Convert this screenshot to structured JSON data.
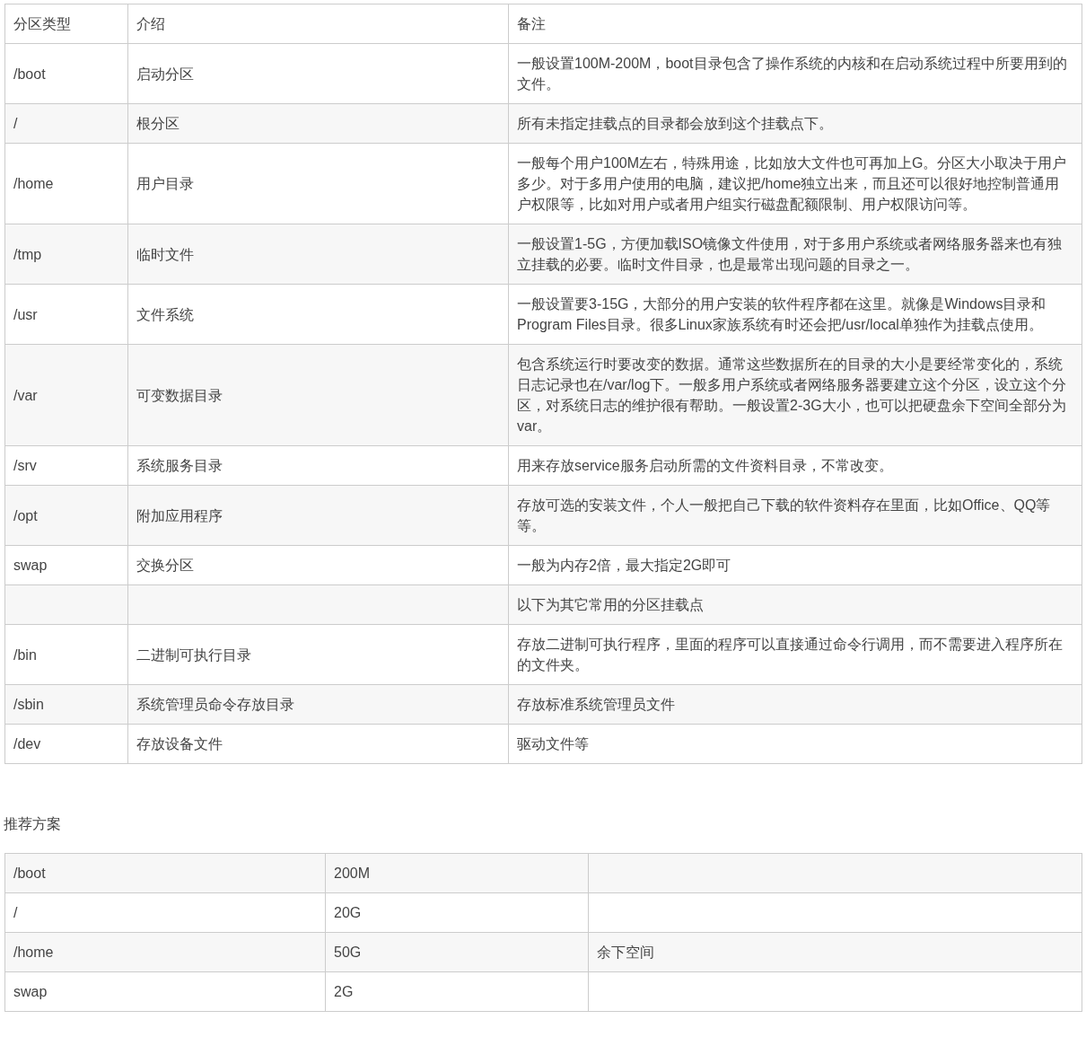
{
  "partition_table": {
    "columns": [
      "分区类型",
      "介绍",
      "备注"
    ],
    "rows": [
      {
        "cells": [
          "/boot",
          "启动分区",
          "一般设置100M-200M，boot目录包含了操作系统的内核和在启动系统过程中所要用到的文件。"
        ]
      },
      {
        "cells": [
          "/",
          "根分区",
          "所有未指定挂载点的目录都会放到这个挂载点下。"
        ]
      },
      {
        "cells": [
          "/home",
          "用户目录",
          "一般每个用户100M左右，特殊用途，比如放大文件也可再加上G。分区大小取决于用户多少。对于多用户使用的电脑，建议把/home独立出来，而且还可以很好地控制普通用户权限等，比如对用户或者用户组实行磁盘配额限制、用户权限访问等。"
        ]
      },
      {
        "cells": [
          "/tmp",
          "临时文件",
          "一般设置1-5G，方便加载ISO镜像文件使用，对于多用户系统或者网络服务器来也有独立挂载的必要。临时文件目录，也是最常出现问题的目录之一。"
        ]
      },
      {
        "cells": [
          "/usr",
          "文件系统",
          "一般设置要3-15G，大部分的用户安装的软件程序都在这里。就像是Windows目录和Program Files目录。很多Linux家族系统有时还会把/usr/local单独作为挂载点使用。"
        ]
      },
      {
        "cells": [
          "/var",
          "可变数据目录",
          "包含系统运行时要改变的数据。通常这些数据所在的目录的大小是要经常变化的，系统日志记录也在/var/log下。一般多用户系统或者网络服务器要建立这个分区，设立这个分区，对系统日志的维护很有帮助。一般设置2-3G大小，也可以把硬盘余下空间全部分为var。"
        ]
      },
      {
        "cells": [
          "/srv",
          "系统服务目录",
          "用来存放service服务启动所需的文件资料目录，不常改变。"
        ]
      },
      {
        "cells": [
          "/opt",
          "附加应用程序",
          "存放可选的安装文件，个人一般把自己下载的软件资料存在里面，比如Office、QQ等等。"
        ]
      },
      {
        "cells": [
          "swap",
          "交换分区",
          "一般为内存2倍，最大指定2G即可"
        ]
      },
      {
        "cells": [
          null,
          null,
          "以下为其它常用的分区挂载点"
        ]
      },
      {
        "cells": [
          "/bin",
          "二进制可执行目录",
          "存放二进制可执行程序，里面的程序可以直接通过命令行调用，而不需要进入程序所在的文件夹。"
        ]
      },
      {
        "cells": [
          "/sbin",
          "系统管理员命令存放目录",
          "存放标准系统管理员文件"
        ]
      },
      {
        "cells": [
          "/dev",
          "存放设备文件",
          "驱动文件等"
        ]
      }
    ]
  },
  "recommendation_heading": "推荐方案",
  "recommendation_table": {
    "rows": [
      {
        "cells": [
          "/boot",
          "200M",
          null
        ]
      },
      {
        "cells": [
          "/",
          "20G",
          null
        ]
      },
      {
        "cells": [
          "/home",
          "50G",
          "余下空间"
        ]
      },
      {
        "cells": [
          "swap",
          "2G",
          null
        ]
      }
    ]
  }
}
